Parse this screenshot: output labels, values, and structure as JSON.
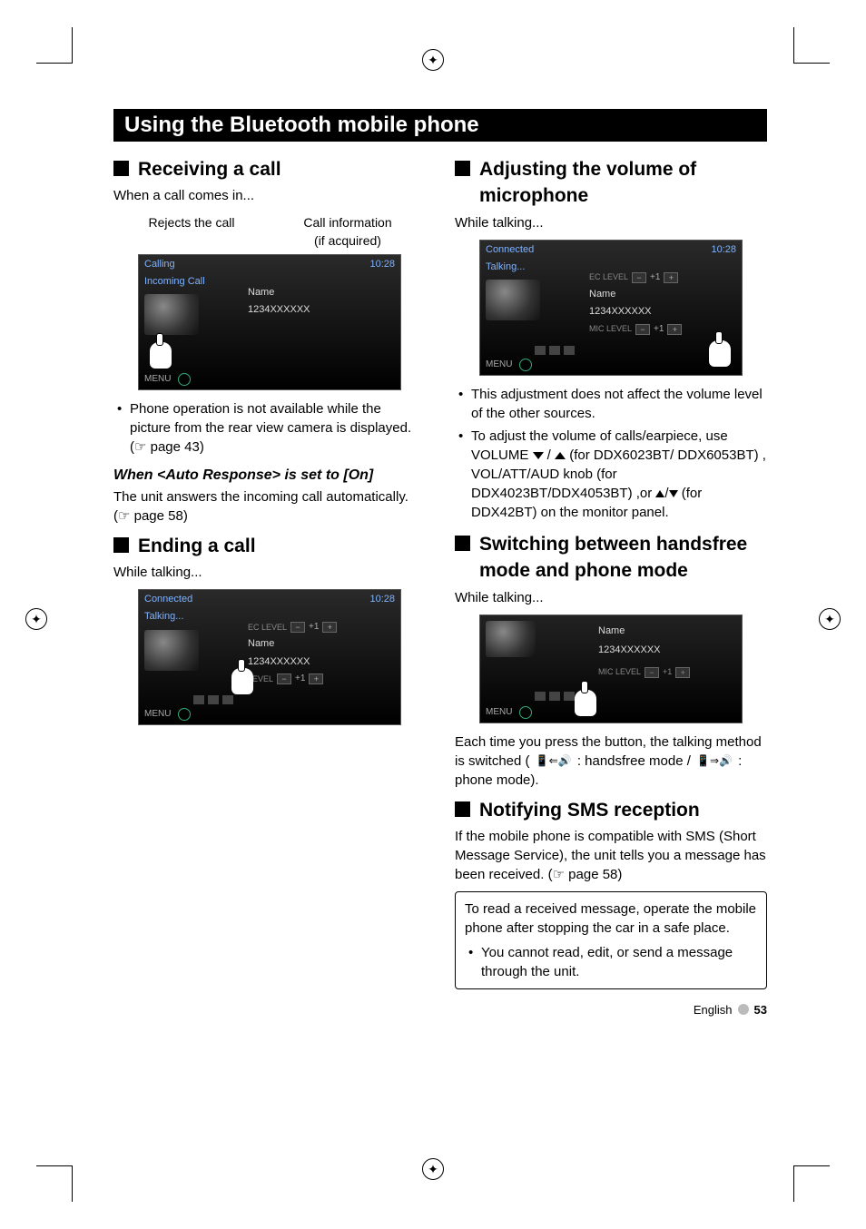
{
  "title_bar": "Using the Bluetooth mobile phone",
  "left": {
    "h_receiving": "Receiving a call",
    "intro_receiving": "When a call comes in...",
    "label_rejects": "Rejects the call",
    "label_callinfo_1": "Call information",
    "label_callinfo_2": "(if acquired)",
    "shot1": {
      "top_status": "Calling",
      "clock": "10:28",
      "side_status": "Incoming Call",
      "name_lbl": "Name",
      "number": "1234XXXXXX",
      "menu": "MENU"
    },
    "bullet1": "Phone operation is not available while the picture from the rear view camera is displayed. (☞ page 43)",
    "subhead": "When <Auto Response> is set to [On]",
    "auto_text": "The unit answers the incoming call automatically. (☞ page 58)",
    "h_ending": "Ending a call",
    "intro_ending": "While talking...",
    "shot2": {
      "top_status": "Connected",
      "clock": "10:28",
      "side_status": "Talking...",
      "ec_lbl": "EC LEVEL",
      "ec_val": "+1",
      "name_lbl": "Name",
      "number": "1234XXXXXX",
      "mic_lbl": "LEVEL",
      "mic_val": "+1",
      "menu": "MENU"
    }
  },
  "right": {
    "h_adjust": "Adjusting the volume of microphone",
    "intro_adjust": "While talking...",
    "shot3": {
      "top_status": "Connected",
      "clock": "10:28",
      "side_status": "Talking...",
      "ec_lbl": "EC LEVEL",
      "ec_val": "+1",
      "name_lbl": "Name",
      "number": "1234XXXXXX",
      "mic_lbl": "MIC LEVEL",
      "mic_val": "+1",
      "menu": "MENU"
    },
    "bullet_a": "This adjustment does not affect the volume level of the other sources.",
    "bullet_b_pre": "To adjust the volume of calls/earpiece, use VOLUME ",
    "bullet_b_mid": " (for DDX6023BT/ DDX6053BT) , VOL/ATT/AUD knob (for DDX4023BT/DDX4053BT) ,or ",
    "bullet_b_post": " (for DDX42BT) on the monitor panel.",
    "h_switch": "Switching between handsfree mode and phone mode",
    "intro_switch": "While talking...",
    "shot4": {
      "name_lbl": "Name",
      "number": "1234XXXXXX",
      "mic_lbl": "MIC LEVEL",
      "mic_val": "+1",
      "menu": "MENU"
    },
    "switch_text_a": "Each time you press the button, the talking method is switched ( ",
    "switch_text_b": " : handsfree mode / ",
    "switch_text_c": " : phone mode).",
    "h_sms": "Notifying SMS reception",
    "sms_text": "If the mobile phone is compatible with SMS (Short Message Service), the unit tells you a message has been received. (☞ page 58)",
    "note_text": "To read a received message, operate the mobile phone after stopping the car in a safe place.",
    "note_bullet": "You cannot read, edit, or send a message through the unit."
  },
  "footer": {
    "lang": "English",
    "page": "53"
  }
}
